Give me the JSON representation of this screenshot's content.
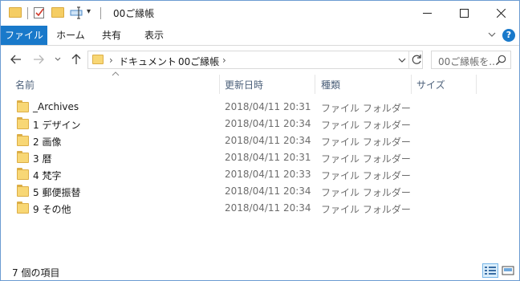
{
  "window": {
    "title": "00ご縁帳",
    "minimize_glyph": "—",
    "maximize_glyph": "☐",
    "close_glyph": "✕"
  },
  "quick_access": {
    "dropdown_glyph": "▾"
  },
  "ribbon": {
    "tabs": [
      "ファイル",
      "ホーム",
      "共有",
      "表示"
    ],
    "expand_glyph": "⌄",
    "help_glyph": "?"
  },
  "nav": {
    "back_glyph": "←",
    "forward_glyph": "→",
    "recent_glyph": "⌄",
    "up_glyph": "↑",
    "breadcrumb": [
      "ドキュメント",
      "00ご縁帳"
    ],
    "breadcrumb_sep": "›",
    "dropdown_glyph": "⌄",
    "refresh_glyph": "↻",
    "search_placeholder": "00ご縁帳を..."
  },
  "columns": {
    "name": "名前",
    "date": "更新日時",
    "type": "種類",
    "size": "サイズ",
    "sort_glyph": "^"
  },
  "files": [
    {
      "name": "_Archives",
      "date": "2018/04/11 20:31",
      "type": "ファイル フォルダー"
    },
    {
      "name": "1 デザイン",
      "date": "2018/04/11 20:34",
      "type": "ファイル フォルダー"
    },
    {
      "name": "2 画像",
      "date": "2018/04/11 20:34",
      "type": "ファイル フォルダー"
    },
    {
      "name": "3 暦",
      "date": "2018/04/11 20:31",
      "type": "ファイル フォルダー"
    },
    {
      "name": "4 梵字",
      "date": "2018/04/11 20:33",
      "type": "ファイル フォルダー"
    },
    {
      "name": "5 郵便振替",
      "date": "2018/04/11 20:34",
      "type": "ファイル フォルダー"
    },
    {
      "name": "9 その他",
      "date": "2018/04/11 20:34",
      "type": "ファイル フォルダー"
    }
  ],
  "status": {
    "item_count": "7 個の項目"
  },
  "colors": {
    "accent": "#1979ca",
    "folder": "#f8d775",
    "header_text": "#4c607a"
  }
}
